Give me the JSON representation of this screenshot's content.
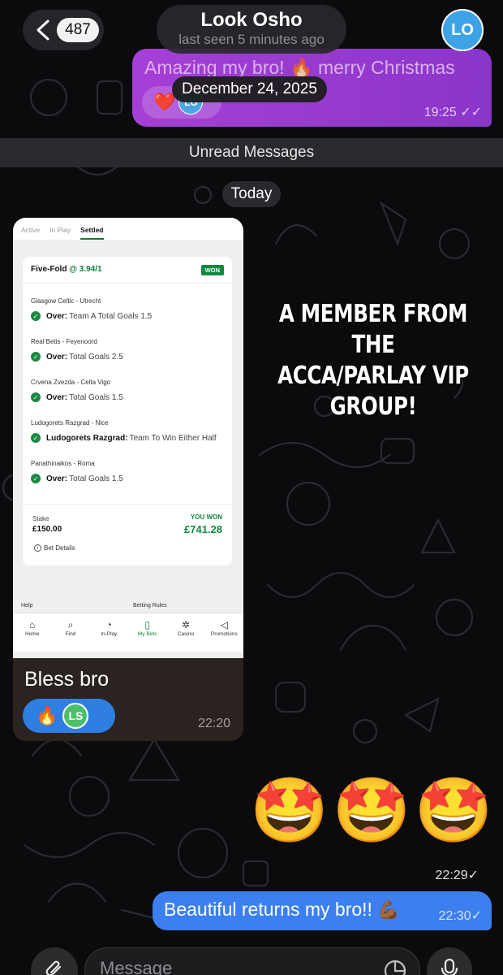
{
  "header": {
    "back_count": "487",
    "contact_name": "Look Osho",
    "status": "last seen 5 minutes ago",
    "avatar_initials": "LO"
  },
  "messages": [
    {
      "type": "outgoing",
      "text": "Amazing my bro! 🔥 merry Christmas",
      "reaction_emoji": "❤️",
      "reaction_avatar": "LO",
      "time": "19:25"
    },
    {
      "type": "incoming-photo",
      "caption": "Bless bro",
      "reaction_emoji": "🔥",
      "reaction_avatar": "LS",
      "time": "22:20"
    },
    {
      "type": "outgoing-emoji",
      "emoji": [
        "🤩",
        "🤩",
        "🤩"
      ],
      "time": "22:29"
    },
    {
      "type": "outgoing",
      "text": "Beautiful returns my bro!! ",
      "emoji": "💪🏾",
      "time": "22:30"
    }
  ],
  "date_pill": "December 24, 2025",
  "unread_label": "Unread Messages",
  "today_label": "Today",
  "promo_text": "A MEMBER FROM THE ACCA/PARLAY VIP GROUP!",
  "bet_screenshot": {
    "tabs": [
      "Active",
      "In Play",
      "Settled"
    ],
    "active_tab": "Settled",
    "bet_type": "Five-Fold",
    "odds": "@ 3.94/1",
    "status_badge": "WON",
    "legs": [
      {
        "match": "Glasgow Celtic - Utrecht",
        "pick_label": "Over:",
        "pick_value": "Team A Total Goals 1.5"
      },
      {
        "match": "Real Betis - Feyenoord",
        "pick_label": "Over:",
        "pick_value": "Total Goals 2.5"
      },
      {
        "match": "Crvena Zvezda - Celta Vigo",
        "pick_label": "Over:",
        "pick_value": "Total Goals 1.5"
      },
      {
        "match": "Ludogorets Razgrad - Nice",
        "pick_label": "Ludogorets Razgrad:",
        "pick_value": "Team To Win Either Half"
      },
      {
        "match": "Panathinaikos - Roma",
        "pick_label": "Over:",
        "pick_value": "Total Goals 1.5"
      }
    ],
    "stake_label": "Stake",
    "stake_value": "£150.00",
    "won_label": "YOU WON",
    "won_value": "£741.28",
    "details_label": "Bet Details",
    "help_label": "Help",
    "rules_label": "Betting Rules",
    "nav": [
      {
        "label": "Home",
        "icon": "home-icon",
        "glyph": "⌂"
      },
      {
        "label": "Find",
        "icon": "search-icon",
        "glyph": "⌕"
      },
      {
        "label": "In-Play",
        "icon": "stopwatch-icon",
        "glyph": "◔"
      },
      {
        "label": "My Bets",
        "icon": "betslip-icon",
        "glyph": "▯"
      },
      {
        "label": "Casino",
        "icon": "chip-icon",
        "glyph": "✲"
      },
      {
        "label": "Promotions",
        "icon": "megaphone-icon",
        "glyph": "◁"
      }
    ],
    "nav_selected": "My Bets"
  },
  "input": {
    "placeholder": "Message"
  },
  "colors": {
    "purple_bubble": "#a63fd6",
    "blue_bubble": "#3b7ff0",
    "bet_green": "#0f8a3f",
    "avatar_blue": "#3ea3e6"
  }
}
